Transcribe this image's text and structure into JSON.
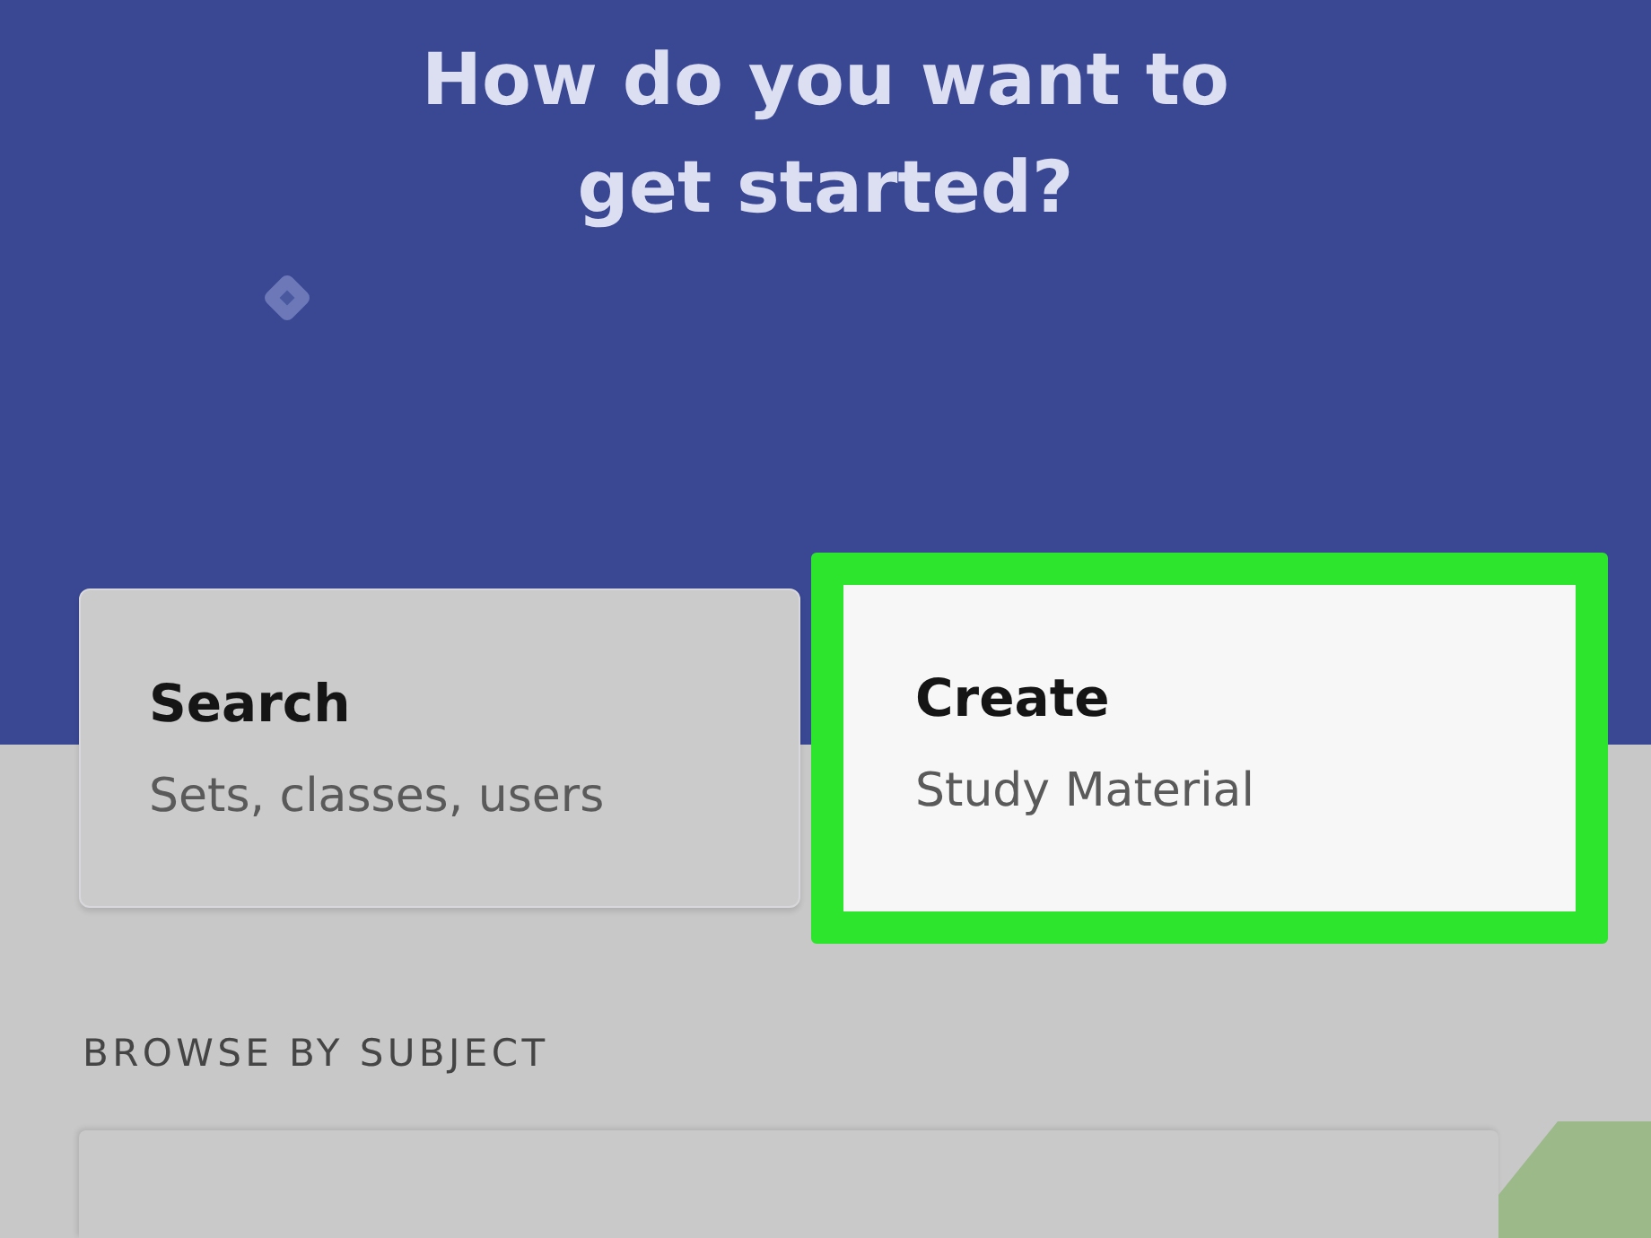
{
  "heading": {
    "title": "How do you want to get started?"
  },
  "options": [
    {
      "title": "Search",
      "subtitle": "Sets, classes, users",
      "highlighted": false
    },
    {
      "title": "Create",
      "subtitle": "Study Material",
      "highlighted": true
    }
  ],
  "browse": {
    "label": "BROWSE BY SUBJECT"
  }
}
